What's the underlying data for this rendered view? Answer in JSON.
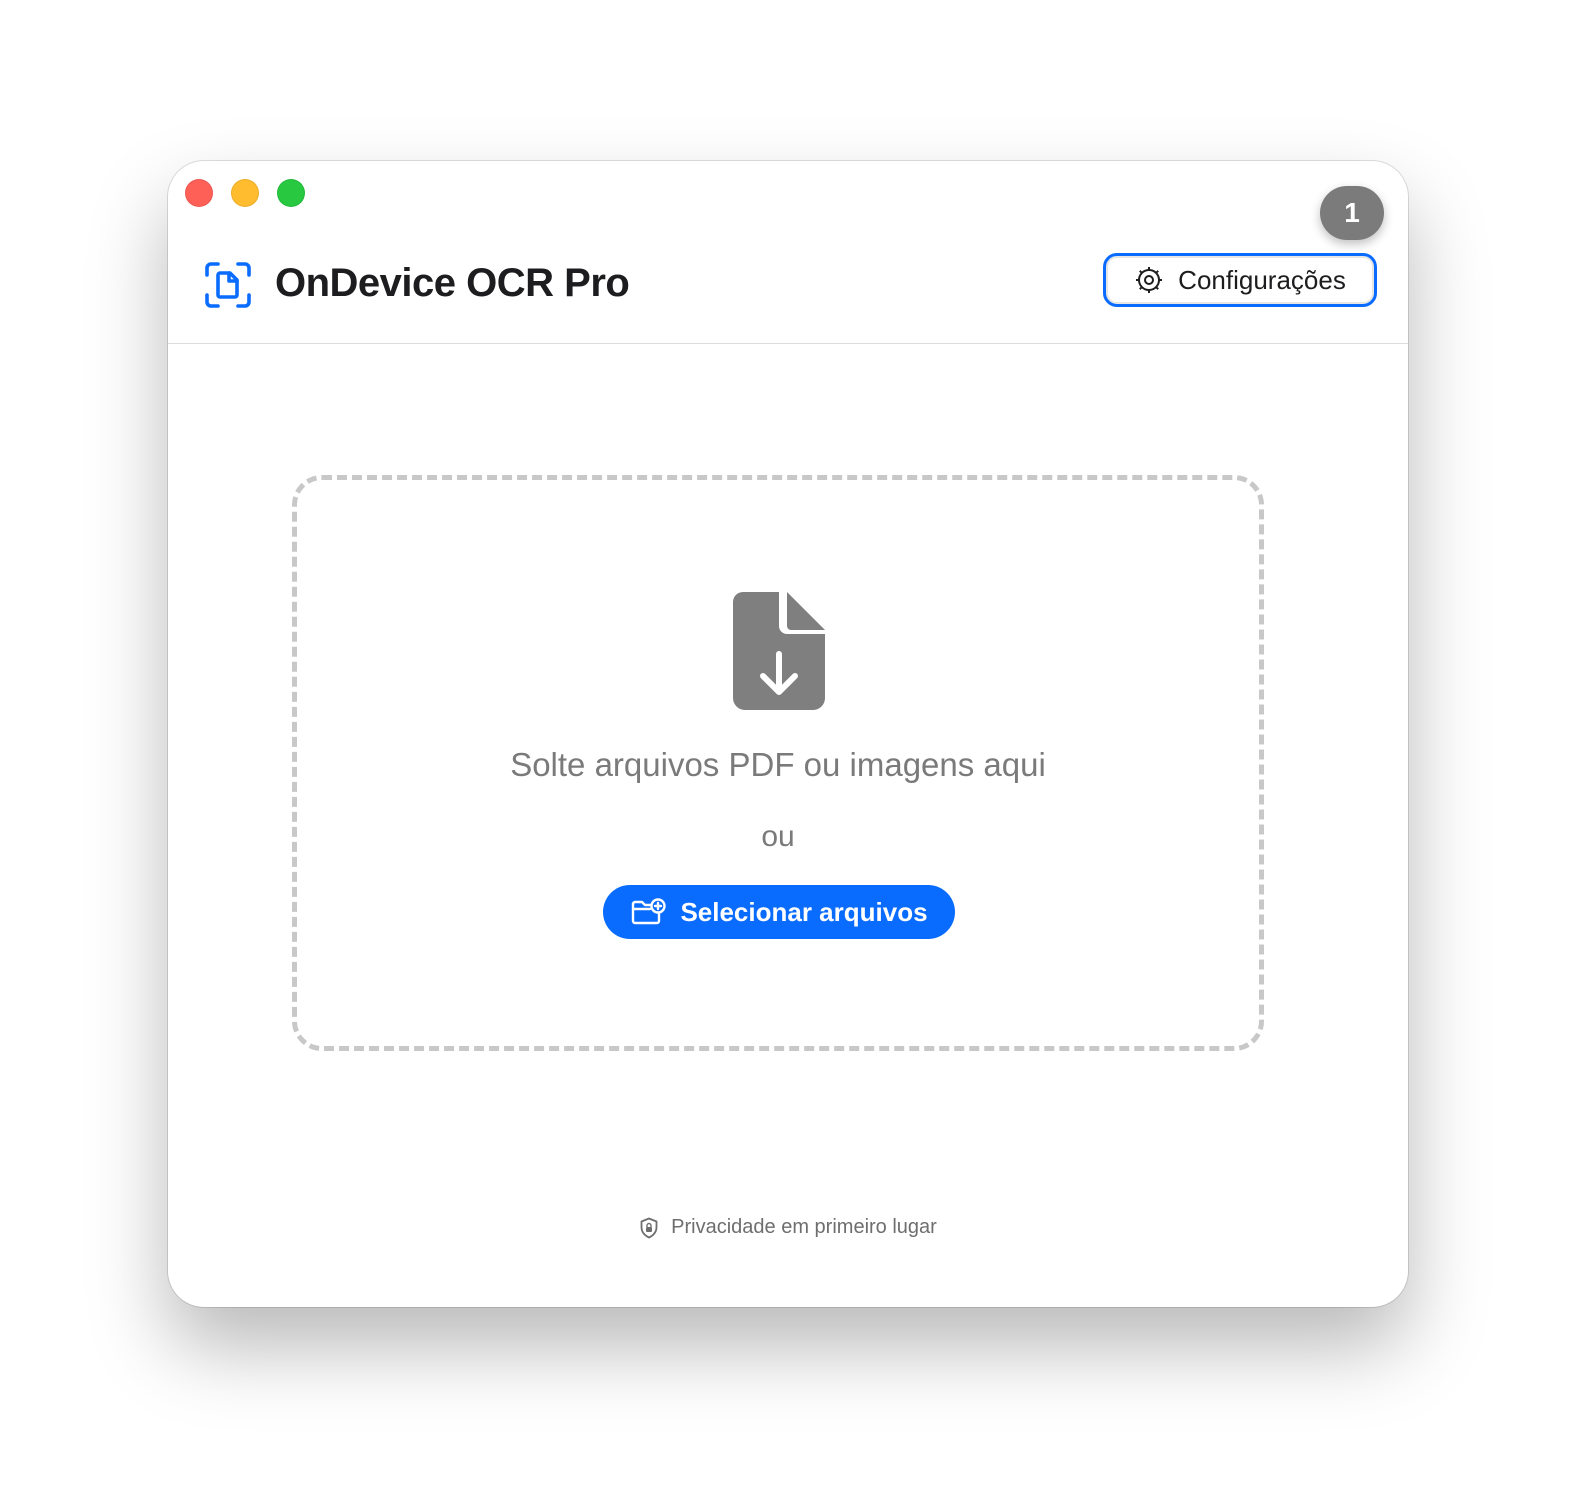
{
  "window": {
    "badge_count": "1"
  },
  "header": {
    "app_icon": "document-scan-icon",
    "title": "OnDevice OCR Pro",
    "settings_icon": "gear-icon",
    "settings_label": "Configurações"
  },
  "dropzone": {
    "icon": "document-download-icon",
    "drop_text": "Solte arquivos PDF ou imagens aqui",
    "or_text": "ou",
    "select_icon": "folder-add-icon",
    "select_label": "Selecionar arquivos"
  },
  "footer": {
    "icon": "shield-lock-icon",
    "text": "Privacidade em primeiro lugar"
  },
  "colors": {
    "accent": "#0a6cff",
    "close": "#fe5f57",
    "minimize": "#febc2e",
    "maximize": "#28c840"
  }
}
